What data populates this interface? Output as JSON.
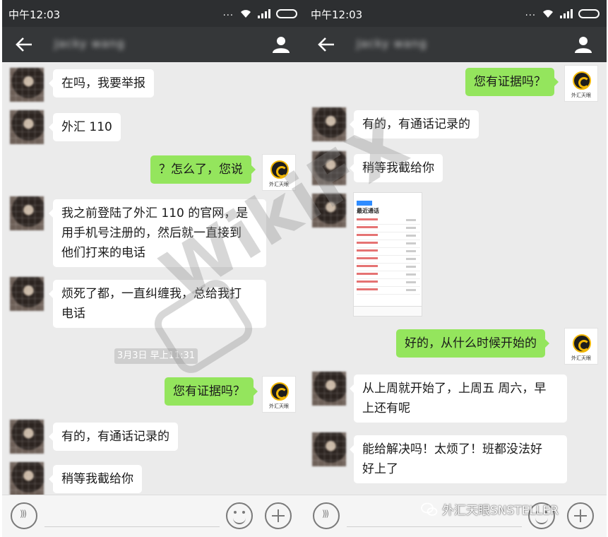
{
  "status_bar": {
    "time": "中午12:03",
    "dots": "..."
  },
  "left_phone": {
    "contact_name": "Jacky wang",
    "timestamp": "3月3日 早上11:31",
    "messages": [
      {
        "side": "in",
        "text": "在吗，我要举报"
      },
      {
        "side": "in",
        "text": "外汇 110"
      },
      {
        "side": "out",
        "text": "？怎么了，您说"
      },
      {
        "side": "in",
        "lines": [
          "我之前登陆了外汇 110 的官网，是",
          "用手机号注册的，然后就一直接到",
          "他们打来的电话"
        ]
      },
      {
        "side": "in",
        "lines": [
          "烦死了都，一直纠缠我，总给我打",
          "电话"
        ]
      },
      {
        "side": "out",
        "text": "您有证据吗？"
      },
      {
        "side": "in",
        "text": "有的，有通话记录的"
      },
      {
        "side": "in",
        "text": "稍等我截给你"
      }
    ]
  },
  "right_phone": {
    "contact_name": "Jacky wang",
    "messages": [
      {
        "side": "out",
        "text": "您有证据吗？"
      },
      {
        "side": "in",
        "text": "有的，有通话记录的"
      },
      {
        "side": "in",
        "text": "稍等我截给你"
      },
      {
        "side": "in",
        "type": "image",
        "caption": "最近通话"
      },
      {
        "side": "out",
        "text": "好的，从什么时候开始的"
      },
      {
        "side": "in",
        "lines": [
          "从上周就开始了，上周五 周六，早",
          "上还有呢"
        ]
      },
      {
        "side": "in",
        "lines": [
          "能给解决吗！太烦了！班都没法好",
          "好上了"
        ]
      }
    ]
  },
  "app_avatar_caption": "外汇天眼",
  "watermark": "WikiFX",
  "credit": "外汇天眼SNSTELLER",
  "colors": {
    "outgoing_bubble": "#94e55d",
    "incoming_bubble": "#ffffff",
    "titlebar": "#353739",
    "chat_bg": "#ebebeb"
  }
}
